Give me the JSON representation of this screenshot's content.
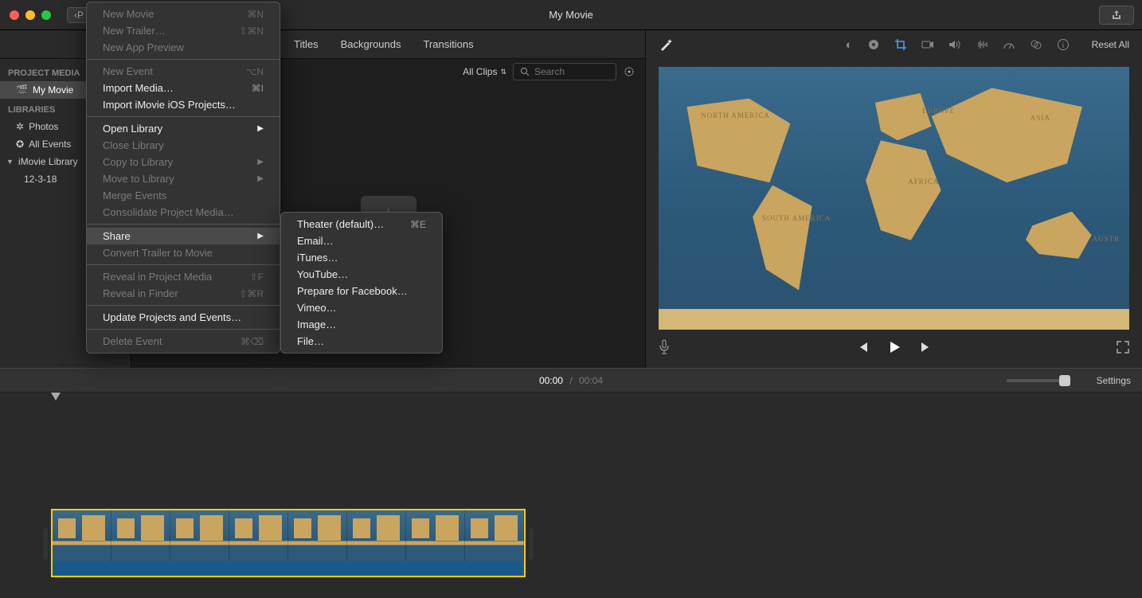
{
  "titlebar": {
    "back_label": "P",
    "title": "My Movie"
  },
  "tabs": {
    "titles": "Titles",
    "backgrounds": "Backgrounds",
    "transitions": "Transitions"
  },
  "filter": {
    "all_clips": "All Clips",
    "search_placeholder": "Search"
  },
  "sidebar": {
    "project_media_header": "PROJECT MEDIA",
    "my_movie": "My Movie",
    "libraries_header": "LIBRARIES",
    "photos": "Photos",
    "all_events": "All Events",
    "imovie_library": "iMovie Library",
    "date_event": "12-3-18"
  },
  "preview": {
    "reset_all": "Reset All",
    "map_labels": {
      "na": "NORTH\nAMERICA",
      "sa": "SOUTH\nAMERICA",
      "eu": "EUROPE",
      "af": "AFRICA",
      "as": "ASIA",
      "au": "AUSTR"
    }
  },
  "timeline": {
    "current_time": "00:00",
    "separator": "/",
    "total_time": "00:04",
    "settings": "Settings"
  },
  "file_menu": {
    "new_movie": {
      "label": "New Movie",
      "shortcut": "⌘N"
    },
    "new_trailer": {
      "label": "New Trailer…",
      "shortcut": "⇧⌘N"
    },
    "new_app_preview": {
      "label": "New App Preview"
    },
    "new_event": {
      "label": "New Event",
      "shortcut": "⌥N"
    },
    "import_media": {
      "label": "Import Media…",
      "shortcut": "⌘I"
    },
    "import_ios": {
      "label": "Import iMovie iOS Projects…"
    },
    "open_library": {
      "label": "Open Library"
    },
    "close_library": {
      "label": "Close Library"
    },
    "copy_to_library": {
      "label": "Copy to Library"
    },
    "move_to_library": {
      "label": "Move to Library"
    },
    "merge_events": {
      "label": "Merge Events"
    },
    "consolidate": {
      "label": "Consolidate Project Media…"
    },
    "share": {
      "label": "Share"
    },
    "convert_trailer": {
      "label": "Convert Trailer to Movie"
    },
    "reveal_project": {
      "label": "Reveal in Project Media",
      "shortcut": "⇧F"
    },
    "reveal_finder": {
      "label": "Reveal in Finder",
      "shortcut": "⇧⌘R"
    },
    "update_projects": {
      "label": "Update Projects and Events…"
    },
    "delete_event": {
      "label": "Delete Event",
      "shortcut": "⌘⌫"
    }
  },
  "share_menu": {
    "theater": {
      "label": "Theater (default)…",
      "shortcut": "⌘E"
    },
    "email": {
      "label": "Email…"
    },
    "itunes": {
      "label": "iTunes…"
    },
    "youtube": {
      "label": "YouTube…"
    },
    "facebook": {
      "label": "Prepare for Facebook…"
    },
    "vimeo": {
      "label": "Vimeo…"
    },
    "image": {
      "label": "Image…"
    },
    "file": {
      "label": "File…"
    }
  }
}
